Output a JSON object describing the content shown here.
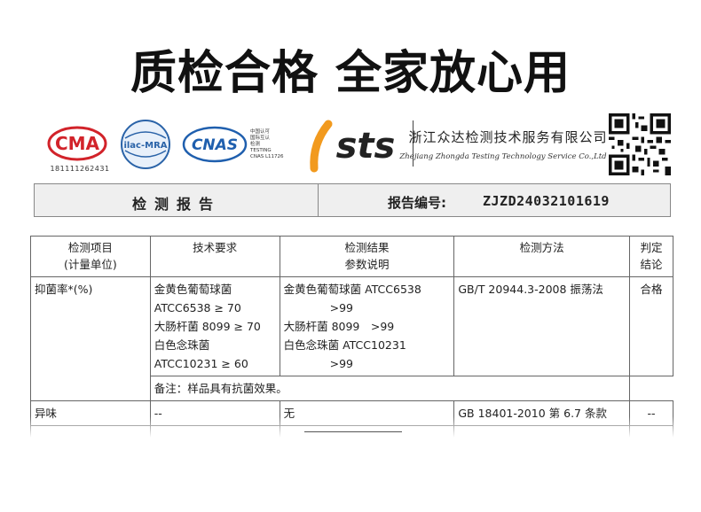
{
  "headline": "质检合格 全家放心用",
  "logos": {
    "cma_text": "CMA",
    "cma_number": "181111262431",
    "ilac_text": "ilac-MRA",
    "cnas_text": "CNAS",
    "cnas_caption": [
      "中国认可",
      "国际互认",
      "检测",
      "TESTING",
      "CNAS L11726"
    ],
    "sts_text": "sts",
    "company_cn": "浙江众达检测技术服务有限公司",
    "company_en": "Zhejiang Zhongda Testing Technology Service Co.,Ltd"
  },
  "report": {
    "title": "检测报告",
    "number_label": "报告编号:",
    "number_value": "ZJZD24032101619"
  },
  "table": {
    "headers": {
      "item": [
        "检测项目",
        "(计量单位)"
      ],
      "requirement": "技术要求",
      "result": [
        "检测结果",
        "参数说明"
      ],
      "method": "检测方法",
      "verdict": [
        "判定",
        "结论"
      ]
    },
    "row1": {
      "item": "抑菌率*(%)",
      "requirement": [
        "金黄色葡萄球菌",
        "ATCC6538 ≥ 70",
        "大肠杆菌 8099 ≥ 70",
        "白色念珠菌",
        "ATCC10231 ≥ 60"
      ],
      "result": [
        "金黄色葡萄球菌 ATCC6538",
        ">99",
        "大肠杆菌 8099　>99",
        "白色念珠菌 ATCC10231",
        ">99"
      ],
      "method": "GB/T 20944.3-2008 振荡法",
      "verdict": "合格",
      "note": "备注：样品具有抗菌效果。"
    },
    "row2": {
      "item": "异味",
      "requirement": "--",
      "result": "无",
      "method": "GB 18401-2010 第 6.7 条款",
      "verdict": "--"
    }
  },
  "colors": {
    "cma_red": "#d2232a",
    "ilac_blue": "#2a63a8",
    "cnas_blue": "#1f5fae",
    "sts_orange": "#f29a1e",
    "bar_gray": "#efefef"
  }
}
